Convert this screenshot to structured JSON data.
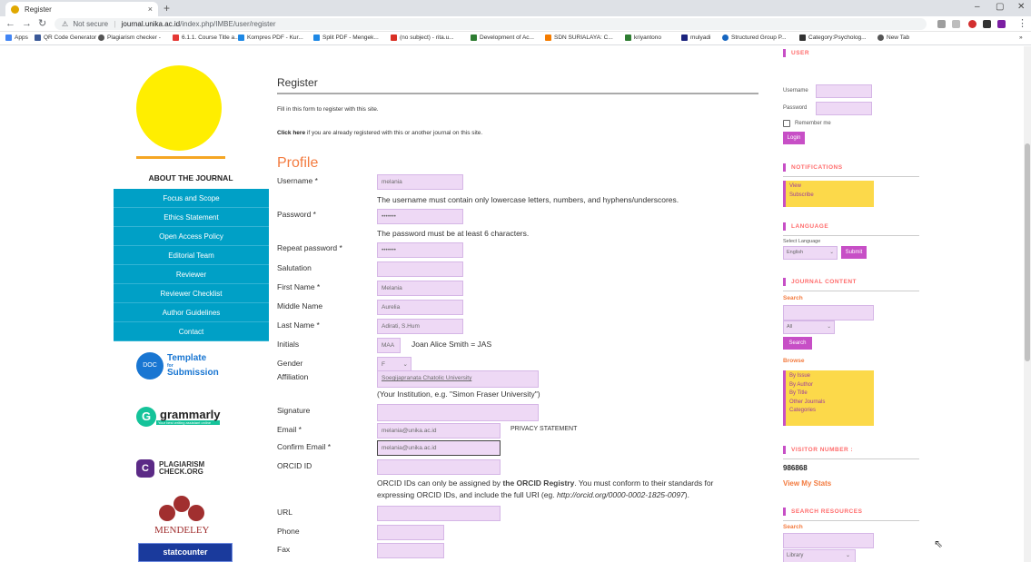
{
  "browser": {
    "tab_title": "Register",
    "tab_close": "×",
    "new_tab": "+",
    "url_warning": "Not secure",
    "url_host": "journal.unika.ac.id",
    "url_path": "/index.php/IMBE/user/register",
    "bookmarks": [
      {
        "label": "Apps",
        "color": "#4285f4"
      },
      {
        "label": "QR Code Generator",
        "color": "#3b5998"
      },
      {
        "label": "Plagiarism checker -",
        "color": "#555555"
      },
      {
        "label": "6.1.1. Course Title a...",
        "color": "#e53935"
      },
      {
        "label": "Kompres PDF - Kur...",
        "color": "#1e88e5"
      },
      {
        "label": "Split PDF - Mengek...",
        "color": "#1e88e5"
      },
      {
        "label": "(no subject) - rita.u...",
        "color": "#d93025"
      },
      {
        "label": "Development of Ac...",
        "color": "#2e7d32"
      },
      {
        "label": "SDN SURIALAYA: C...",
        "color": "#f57c00"
      },
      {
        "label": "kriyantono",
        "color": "#2e7d32"
      },
      {
        "label": "mulyadi",
        "color": "#1a237e"
      },
      {
        "label": "Structured Group P...",
        "color": "#1565c0"
      },
      {
        "label": "Category:Psycholog...",
        "color": "#333333"
      },
      {
        "label": "New Tab",
        "color": "#555555"
      }
    ]
  },
  "sidebar": {
    "about_title": "ABOUT THE JOURNAL",
    "menu": [
      "Focus and Scope",
      "Ethics Statement",
      "Open Access Policy",
      "Editorial Team",
      "Reviewer",
      "Reviewer Checklist",
      "Author Guidelines",
      "Contact"
    ],
    "template_l1": "Template",
    "template_l2": "for",
    "template_l3": "Submission",
    "grammarly": "grammarly",
    "grammarly_sub": "Your best writing assistant online",
    "plag_l1": "PLAGIARISM",
    "plag_l2": "CHECK.ORG",
    "mendeley": "MENDELEY",
    "statcounter": "statcounter"
  },
  "main": {
    "title": "Register",
    "intro": "Fill in this form to register with this site.",
    "click_here": "Click here",
    "already_text": " if you are already registered with this or another journal on this site.",
    "profile_heading": "Profile",
    "username_label": "Username *",
    "username_value": "melania",
    "username_hint": "The username must contain only lowercase letters, numbers, and hyphens/underscores.",
    "password_label": "Password *",
    "password_value": "•••••••",
    "password_hint": "The password must be at least 6 characters.",
    "repeat_label": "Repeat password *",
    "repeat_value": "•••••••",
    "salutation_label": "Salutation",
    "first_label": "First Name *",
    "first_value": "Melania",
    "middle_label": "Middle Name",
    "middle_value": "Aurelia",
    "last_label": "Last Name *",
    "last_value": "Adirati, S.Hum",
    "initials_label": "Initials",
    "initials_value": "MAA",
    "initials_hint": "Joan Alice Smith = JAS",
    "gender_label": "Gender",
    "gender_value": "F",
    "affiliation_label": "Affiliation",
    "affiliation_value": "Soegijapranata Chatolic University",
    "affiliation_hint": "(Your Institution, e.g. \"Simon Fraser University\")",
    "signature_label": "Signature",
    "email_label": "Email *",
    "email_value": "melania@unika.ac.id",
    "privacy": "PRIVACY STATEMENT",
    "confirm_label": "Confirm Email *",
    "confirm_value": "melania@unika.ac.id",
    "orcid_label": "ORCID ID",
    "orcid_hint_1a": "ORCID IDs can only be assigned by ",
    "orcid_hint_1b": "the ORCID Registry",
    "orcid_hint_1c": ". You must conform to their standards for",
    "orcid_hint_2a": "expressing ORCID IDs, and include the full URI (eg. ",
    "orcid_hint_2b": "http://orcid.org/0000-0002-1825-0097",
    "orcid_hint_2c": ").",
    "url_label": "URL",
    "phone_label": "Phone",
    "fax_label": "Fax"
  },
  "right": {
    "user_title": "USER",
    "username_label": "Username",
    "password_label": "Password",
    "remember": "Remember me",
    "login": "Login",
    "notif_title": "NOTIFICATIONS",
    "notif_items": [
      "View",
      "Subscribe"
    ],
    "lang_title": "LANGUAGE",
    "select_lang": "Select Language",
    "lang_value": "English",
    "lang_submit": "Submit",
    "content_title": "JOURNAL CONTENT",
    "search_label": "Search",
    "search_scope": "All",
    "search_btn": "Search",
    "browse_label": "Browse",
    "browse_items": [
      "By Issue",
      "By Author",
      "By Title",
      "Other Journals",
      "Categories"
    ],
    "visitor_title": "VISITOR NUMBER :",
    "visitor_count": "986868",
    "view_stats": "View My Stats",
    "resources_title": "SEARCH RESOURCES",
    "res_search": "Search",
    "res_select": "Library"
  }
}
